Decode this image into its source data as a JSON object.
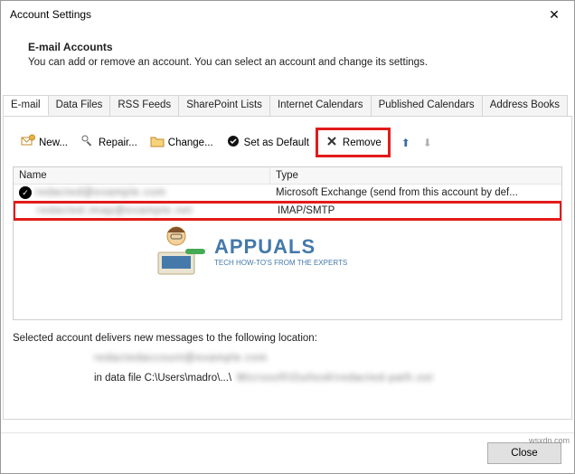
{
  "window": {
    "title": "Account Settings"
  },
  "header": {
    "title": "E-mail Accounts",
    "subtitle": "You can add or remove an account. You can select an account and change its settings."
  },
  "tabs": {
    "items": [
      "E-mail",
      "Data Files",
      "RSS Feeds",
      "SharePoint Lists",
      "Internet Calendars",
      "Published Calendars",
      "Address Books"
    ],
    "active": 0
  },
  "toolbar": {
    "new_label": "New...",
    "repair_label": "Repair...",
    "change_label": "Change...",
    "set_default_label": "Set as Default",
    "remove_label": "Remove"
  },
  "list": {
    "columns": {
      "name": "Name",
      "type": "Type"
    },
    "rows": [
      {
        "name_redacted": "redacted@example.com",
        "type": "Microsoft Exchange (send from this account by def...",
        "default": true
      },
      {
        "name_redacted": "redacted.imap@example.net",
        "type": "IMAP/SMTP",
        "default": false,
        "highlighted": true
      }
    ]
  },
  "delivers": {
    "line1": "Selected account delivers new messages to the following location:",
    "line2_prefix": "in data file C:\\Users\\madro\\...\\"
  },
  "footer": {
    "close_label": "Close"
  },
  "watermark": {
    "brand": "APPUALS",
    "tag": "TECH HOW-TO'S FROM THE EXPERTS",
    "corner": "wsxdn.com"
  }
}
